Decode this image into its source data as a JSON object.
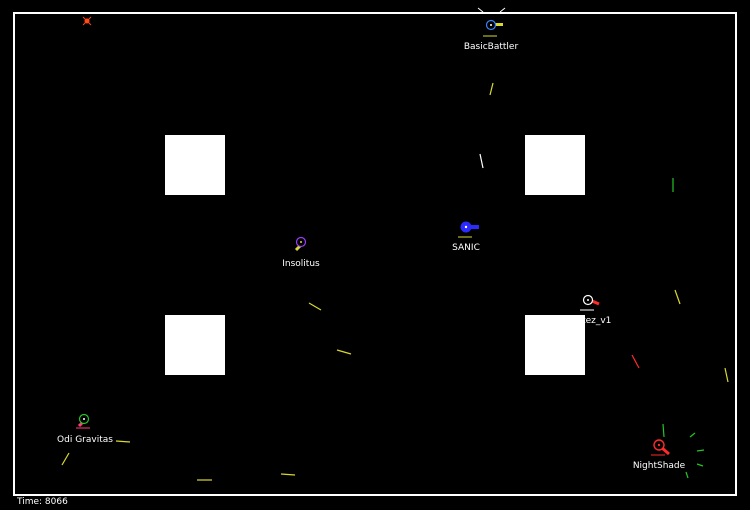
{
  "hud": {
    "time_label": "Time: 8066"
  },
  "colors": {
    "background": "#000000",
    "arena_border": "#ffffff",
    "obstacle": "#ffffff"
  },
  "bots": [
    {
      "name": "BasicBattler",
      "body_color": "#ffffff",
      "ring_color": "#3b82f6",
      "gun_color": "#d8d832"
    },
    {
      "name": "SANIC",
      "body_color": "#2b2bff",
      "ring_color": "#2b2bff",
      "gun_color": "#2b2bff"
    },
    {
      "name": "Insolitus",
      "body_color": "#ffffff",
      "ring_color": "#9d3cff",
      "gun_color": "#d8d832"
    },
    {
      "name": "Cortez_v1",
      "body_color": "#ffffff",
      "ring_color": "#ffffff",
      "gun_color": "#ff2a2a"
    },
    {
      "name": "Odi Gravitas",
      "body_color": "#ffffff",
      "ring_color": "#25c425",
      "gun_color": "#ff3b7a"
    },
    {
      "name": "NightShade",
      "body_color": "#ff2a2a",
      "ring_color": "#ff2a2a",
      "gun_color": "#ff2a2a"
    }
  ],
  "projectile_colors": {
    "yellow": "#d8d832",
    "green": "#25c425",
    "red": "#ff2a2a",
    "white": "#ffffff"
  }
}
